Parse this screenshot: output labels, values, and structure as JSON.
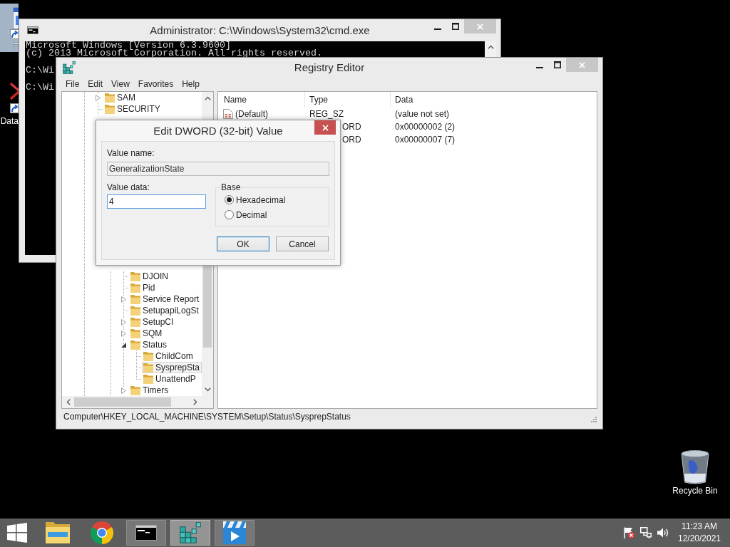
{
  "desktop": {
    "icons": [
      {
        "kind": "window",
        "label": "T",
        "selected": true
      },
      {
        "kind": "cross",
        "label": "Data",
        "selected": false
      },
      {
        "kind": "bin",
        "label": "Recycle Bin",
        "selected": false
      }
    ]
  },
  "console_window": {
    "title": "Administrator: C:\\Windows\\System32\\cmd.exe",
    "active": false,
    "paragraphs": [
      [
        "Microsoft Windows [Version 6.3.9600]",
        "(c) 2013 Microsoft Corporation. All rights reserved."
      ],
      [
        "C:\\Wi"
      ],
      [
        "C:\\Wi"
      ]
    ]
  },
  "registry_window": {
    "title": "Registry Editor",
    "active": false,
    "menu": [
      "File",
      "Edit",
      "View",
      "Favorites",
      "Help"
    ],
    "tree": {
      "upper_items": [
        {
          "label": "SAM",
          "expandable": true,
          "expanded": false,
          "selected": false
        },
        {
          "label": "SECURITY",
          "expandable": false,
          "expanded": false,
          "selected": false
        }
      ],
      "lower_items": [
        {
          "label": "DJOIN",
          "expandable": false,
          "expanded": false,
          "selected": false
        },
        {
          "label": "Pid",
          "expandable": false,
          "expanded": false,
          "selected": false
        },
        {
          "label": "Service Report",
          "expandable": true,
          "expanded": false,
          "selected": false
        },
        {
          "label": "SetupapiLogSt",
          "expandable": false,
          "expanded": false,
          "selected": false
        },
        {
          "label": "SetupCI",
          "expandable": true,
          "expanded": false,
          "selected": false
        },
        {
          "label": "SQM",
          "expandable": true,
          "expanded": false,
          "selected": false
        },
        {
          "label": "Status",
          "expandable": true,
          "expanded": true,
          "selected": false,
          "children": [
            {
              "label": "ChildCom",
              "expandable": false,
              "expanded": false,
              "selected": false
            },
            {
              "label": "SysprepSta",
              "expandable": false,
              "expanded": false,
              "selected": true
            },
            {
              "label": "UnattendP",
              "expandable": false,
              "expanded": false,
              "selected": false
            }
          ]
        },
        {
          "label": "Timers",
          "expandable": true,
          "expanded": false,
          "selected": false
        }
      ]
    },
    "list": {
      "columns": [
        "Name",
        "Type",
        "Data"
      ],
      "rows": [
        {
          "kind": "string",
          "name": "(Default)",
          "type": "REG_SZ",
          "data": "(value not set)"
        },
        {
          "kind": "covered",
          "type": "ORD",
          "data": "0x00000002 (2)"
        },
        {
          "kind": "covered",
          "type": "ORD",
          "data": "0x00000007 (7)"
        }
      ]
    },
    "status_bar": "Computer\\HKEY_LOCAL_MACHINE\\SYSTEM\\Setup\\Status\\SysprepStatus"
  },
  "dialog": {
    "title": "Edit DWORD (32-bit) Value",
    "active": true,
    "value_name": {
      "label": "Value name:",
      "value": "GeneralizationState",
      "read_only": true,
      "focused": false
    },
    "value_data": {
      "label": "Value data:",
      "value": "4",
      "read_only": false,
      "focused": true
    },
    "base": {
      "label": "Base",
      "options": [
        {
          "label": "Hexadecimal",
          "selected": true
        },
        {
          "label": "Decimal",
          "selected": false
        }
      ]
    },
    "buttons": [
      {
        "label": "OK",
        "default": true
      },
      {
        "label": "Cancel",
        "default": false
      }
    ]
  },
  "taskbar": {
    "buttons": [
      {
        "kind": "start",
        "running": false,
        "selected": false
      },
      {
        "kind": "explorer",
        "running": false,
        "selected": false
      },
      {
        "kind": "browser",
        "running": false,
        "selected": false
      },
      {
        "kind": "console",
        "running": true,
        "selected": false
      },
      {
        "kind": "registry",
        "running": true,
        "selected": true
      },
      {
        "kind": "media",
        "running": true,
        "selected": false
      }
    ],
    "clock": {
      "time": "11:23 AM",
      "date": "12/20/2021"
    }
  }
}
